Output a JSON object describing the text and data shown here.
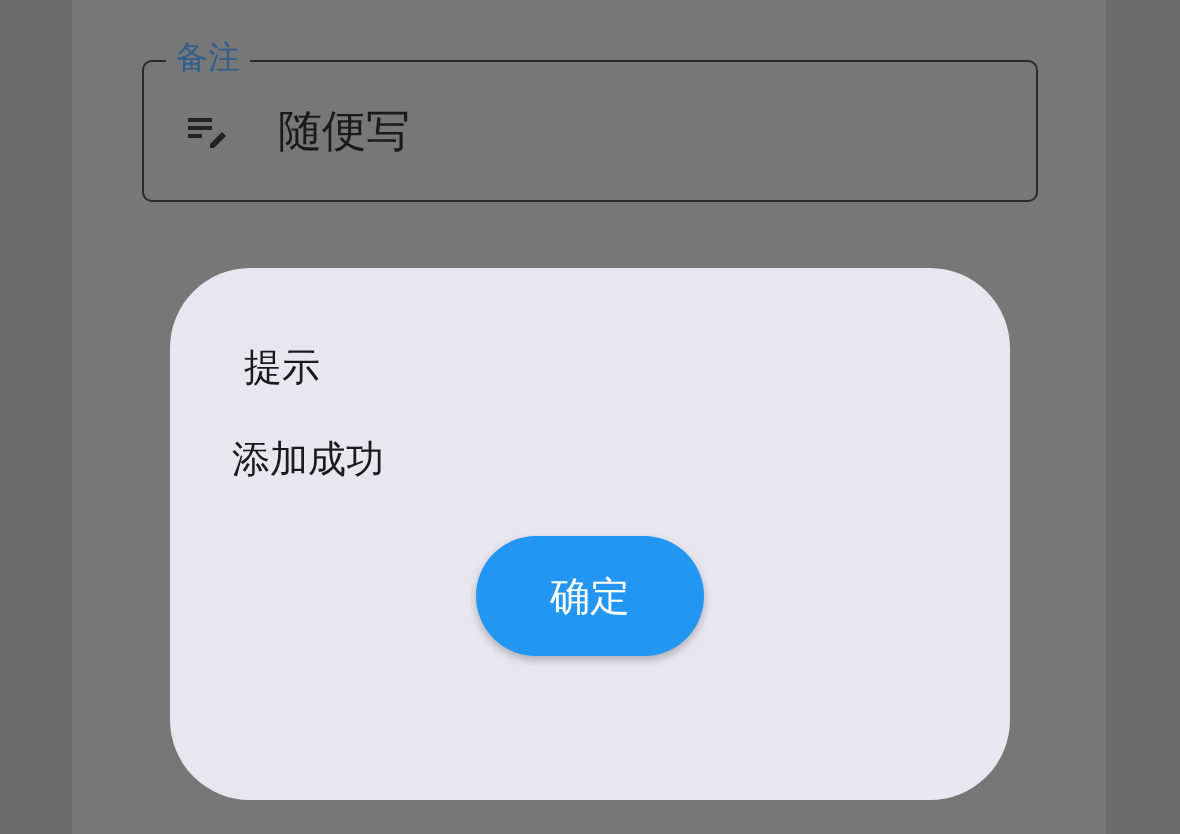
{
  "form": {
    "note_field": {
      "label": "备注",
      "value": "随便写"
    }
  },
  "dialog": {
    "title": "提示",
    "message": "添加成功",
    "buttons": [
      "确定"
    ]
  }
}
